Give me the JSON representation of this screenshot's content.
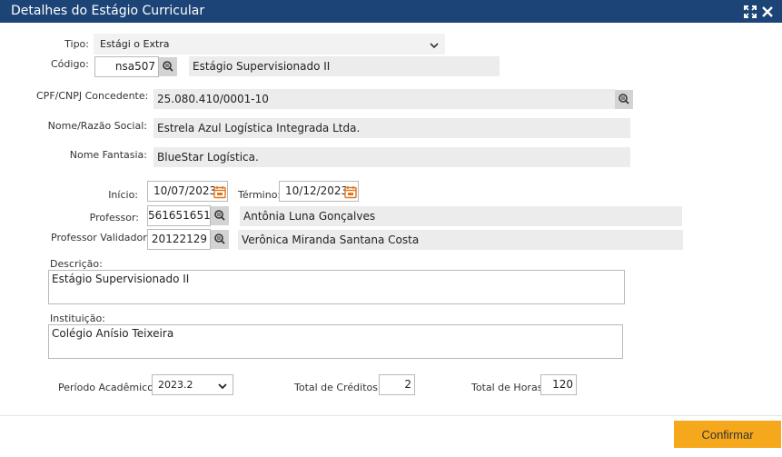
{
  "window": {
    "title": "Detalhes do Estágio Curricular"
  },
  "fields": {
    "tipo": {
      "label": "Tipo:",
      "value": "Estági o Extra"
    },
    "codigo": {
      "label": "Código:",
      "value": "nsa507",
      "description": "Estágio Supervisionado II"
    },
    "cpf_cnpj": {
      "label": "CPF/CNPJ Concedente:",
      "value": "25.080.410/0001-10"
    },
    "nome_razao": {
      "label": "Nome/Razão Social:",
      "value": "Estrela Azul Logística Integrada Ltda."
    },
    "nome_fantasia": {
      "label": "Nome Fantasia:",
      "value": "BlueStar Logística."
    },
    "inicio": {
      "label": "Início:",
      "value": "10/07/2023"
    },
    "termino": {
      "label": "Término:",
      "value": "10/12/2023"
    },
    "professor": {
      "label": "Professor:",
      "value": "561651651",
      "name": "Antônia Luna Gonçalves"
    },
    "professor_validador": {
      "label": "Professor Validador:",
      "value": "20122129",
      "name": "Verônica Miranda Santana Costa"
    },
    "descricao": {
      "label": "Descrição:",
      "value": "Estágio Supervisionado II"
    },
    "instituicao": {
      "label": "Instituição:",
      "value": "Colégio Anísio Teixeira"
    },
    "periodo": {
      "label": "Período Acadêmico:",
      "value": "2023.2"
    },
    "total_creditos": {
      "label": "Total de Créditos:",
      "value": "2"
    },
    "total_horas": {
      "label": "Total de Horas:",
      "value": "120"
    }
  },
  "actions": {
    "confirm_label": "Confirmar"
  },
  "colors": {
    "titlebar": "#1d4476",
    "confirm": "#f6a81d",
    "readonly": "#ececec",
    "calendar": "#e0761c"
  },
  "icons": {
    "lookup": "search-list-icon",
    "calendar": "calendar-icon",
    "expand": "expand-icon",
    "close": "close-icon"
  }
}
